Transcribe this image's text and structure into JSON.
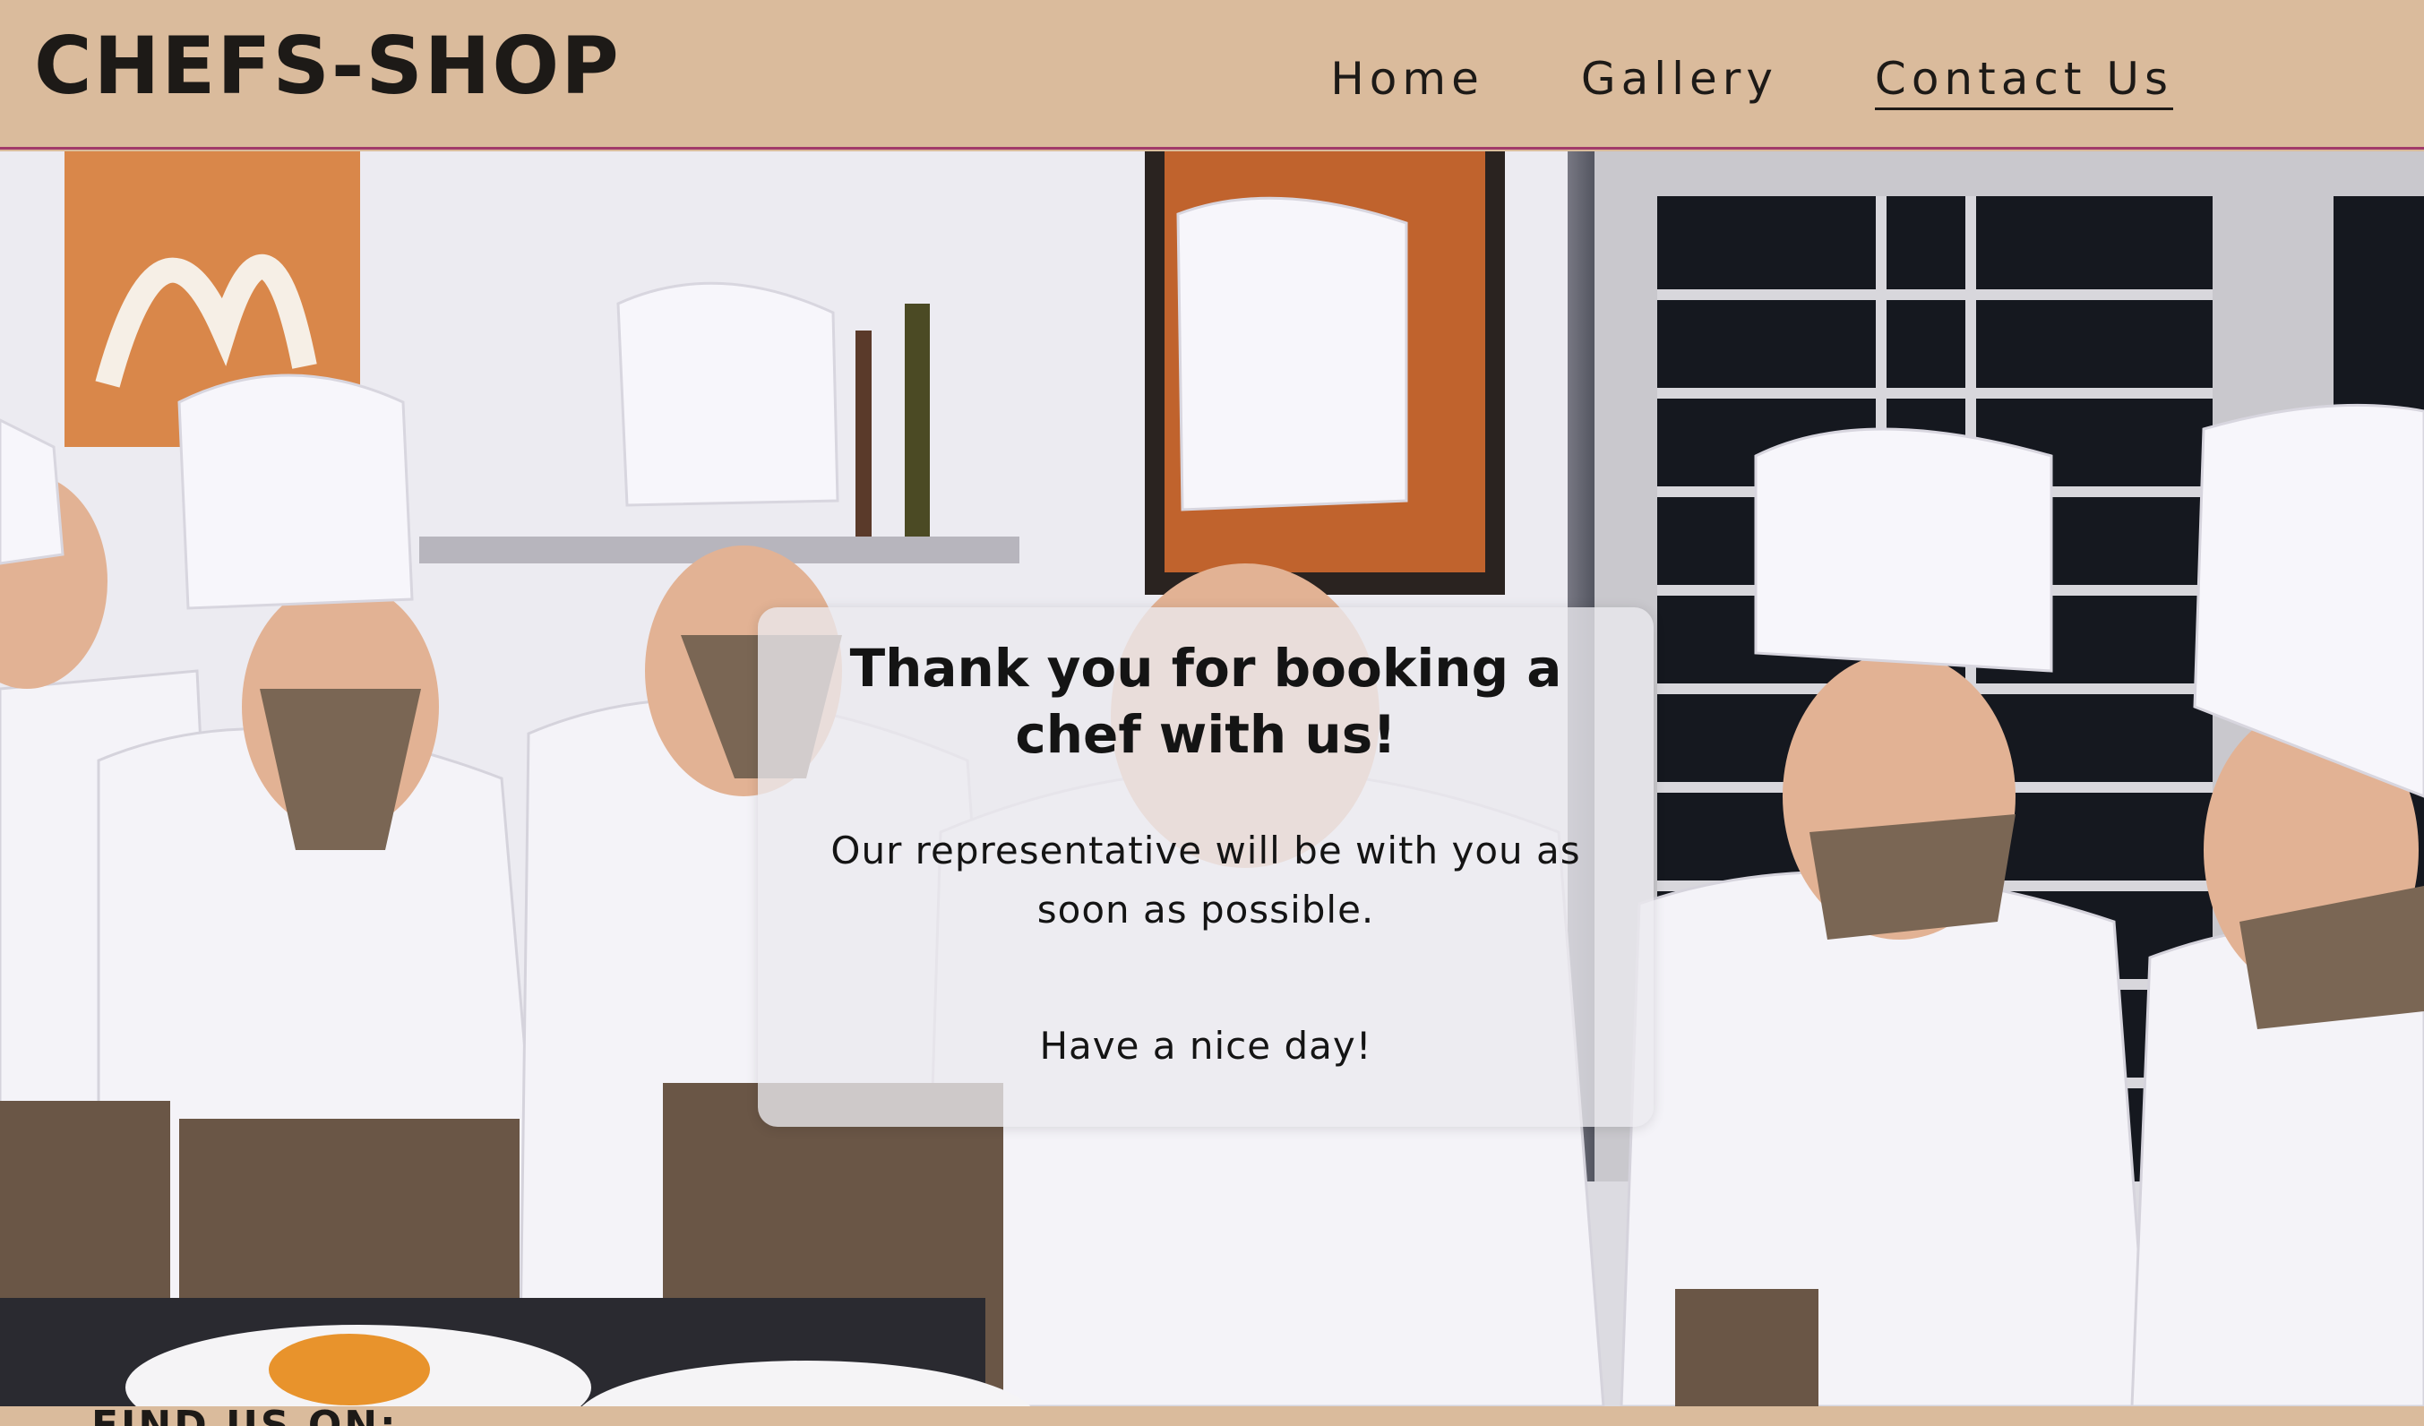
{
  "header": {
    "logo": "CHEFS-SHOP",
    "nav": [
      {
        "label": "Home",
        "active": false
      },
      {
        "label": "Gallery",
        "active": false
      },
      {
        "label": "Contact Us",
        "active": true
      }
    ]
  },
  "hero": {
    "image_description_icon": "chefs-photo"
  },
  "card": {
    "title": "Thank you for booking a chef with us!",
    "message": "Our representative will be with you as soon as possible.",
    "closing": "Have a nice day!"
  },
  "footer": {
    "find_us": "FIND US ON:"
  },
  "colors": {
    "header_bg": "#dabb9c",
    "header_border": "#a13a6a",
    "text": "#1d1a17",
    "card_bg": "#ebe9ee"
  }
}
